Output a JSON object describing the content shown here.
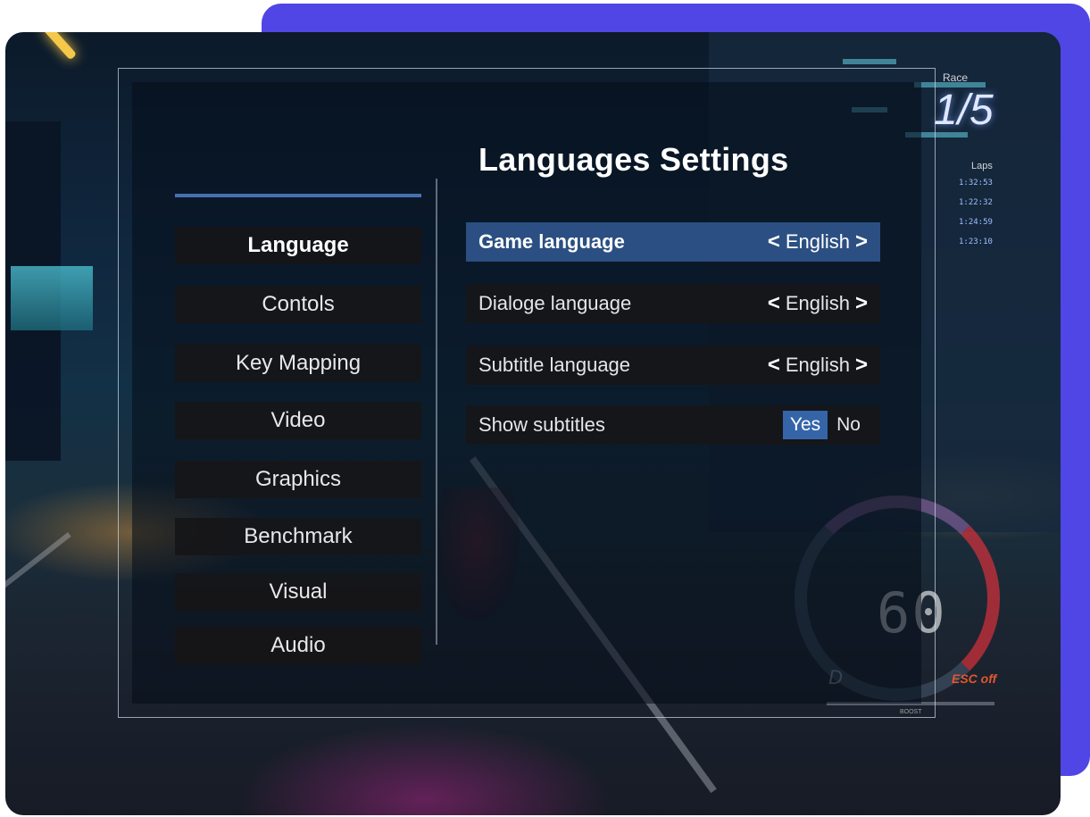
{
  "hud": {
    "race_label": "Race",
    "position": "1/5",
    "laps_label": "Laps",
    "lap_times": [
      "1:32:53",
      "1:22:32",
      "1:24:59",
      "1:23:10"
    ],
    "speed": "60",
    "gear": "D",
    "esc_status": "ESC off",
    "boost_label": "BOOST"
  },
  "nav": {
    "items": [
      {
        "label": "Language",
        "active": true
      },
      {
        "label": "Contols",
        "active": false
      },
      {
        "label": "Key Mapping",
        "active": false
      },
      {
        "label": "Video",
        "active": false
      },
      {
        "label": "Graphics",
        "active": false
      },
      {
        "label": "Benchmark",
        "active": false
      },
      {
        "label": "Visual",
        "active": false
      },
      {
        "label": "Audio",
        "active": false
      }
    ]
  },
  "settings": {
    "title": "Languages Settings",
    "game_language": {
      "label": "Game language",
      "value": "English"
    },
    "dialogue_language": {
      "label": "Dialoge language",
      "value": "English"
    },
    "subtitle_language": {
      "label": "Subtitle language",
      "value": "English"
    },
    "show_subtitles": {
      "label": "Show subtitles",
      "yes": "Yes",
      "no": "No",
      "selected": "Yes"
    },
    "prev_glyph": "<",
    "next_glyph": ">"
  },
  "colors": {
    "accent_card": "#4f46e5",
    "selected_row": "#2b4f82",
    "toggle_on": "#3564a8",
    "nav_accent": "#4a6fb0"
  }
}
